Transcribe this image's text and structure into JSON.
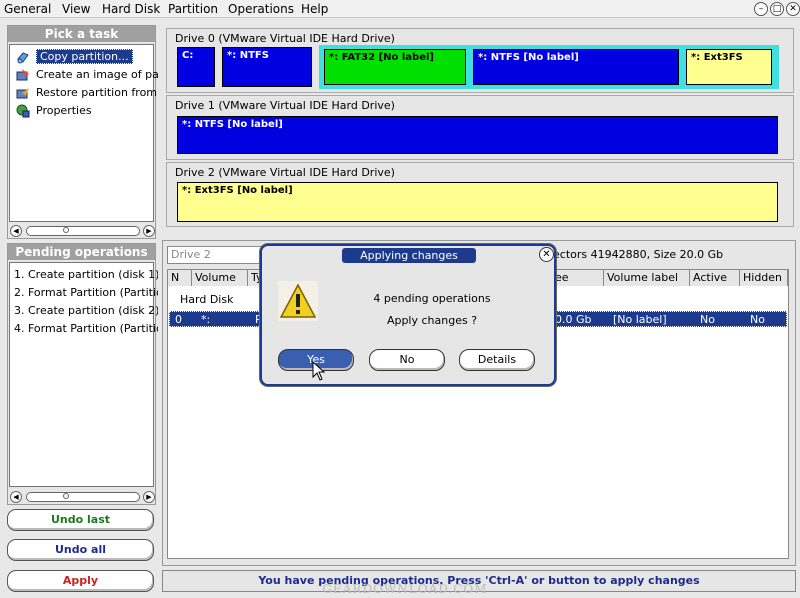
{
  "menubar": {
    "items": [
      "General",
      "View",
      "Hard Disk",
      "Partition",
      "Operations",
      "Help"
    ],
    "window_buttons": [
      "minimize-icon",
      "maximize-icon",
      "close-icon"
    ]
  },
  "tasks": {
    "title": "Pick a task",
    "items": [
      {
        "label": "Copy partition...",
        "icon": "copy-partition-icon"
      },
      {
        "label": "Create an image of pa",
        "icon": "create-image-icon"
      },
      {
        "label": "Restore partition from",
        "icon": "restore-partition-icon"
      },
      {
        "label": "Properties",
        "icon": "properties-icon"
      }
    ]
  },
  "pending": {
    "title": "Pending operations",
    "items": [
      "1. Create partition (disk 1)",
      "2. Format Partition (Partitio",
      "3. Create partition (disk 2)",
      "4. Format Partition (Partitio"
    ]
  },
  "buttons": {
    "undo_last": "Undo last",
    "undo_all": "Undo all",
    "apply": "Apply"
  },
  "drives": [
    {
      "title": "Drive 0 (VMware Virtual IDE Hard Drive)",
      "partitions": [
        "C:",
        "*: NTFS",
        "*: FAT32 [No label]",
        "*: NTFS [No label]",
        "*: Ext3FS"
      ]
    },
    {
      "title": "Drive 1 (VMware Virtual IDE Hard Drive)",
      "partitions": [
        "*: NTFS [No label]"
      ]
    },
    {
      "title": "Drive 2 (VMware Virtual IDE Hard Drive)",
      "partitions": [
        "*: Ext3FS [No label]"
      ]
    }
  ],
  "details": {
    "drive_select": "Drive 2",
    "info": "ectors 41942880, Size 20.0 Gb",
    "columns": [
      "N",
      "Volume",
      "Ty",
      "ee",
      "Volume label",
      "Active",
      "Hidden"
    ],
    "group_label": "Hard Disk",
    "row": [
      "0",
      "*:",
      "P",
      "0.0 Gb",
      "[No label]",
      "No",
      "No"
    ]
  },
  "dialog": {
    "title": "Applying changes",
    "message1": "4 pending operations",
    "message2": "Apply changes ?",
    "yes": "Yes",
    "no": "No",
    "details": "Details",
    "icon": "warning-icon"
  },
  "status": "You have pending operations. Press 'Ctrl-A' or button to apply changes",
  "watermark": "GEARDOWNLOAD.COM",
  "colors": {
    "selection": "#1d3b8e",
    "ntfs": "#0000e0",
    "fat32": "#00e000",
    "ext3fs": "#ffff90",
    "undo_text": "#1a7a1a",
    "apply_text": "#d02020"
  }
}
